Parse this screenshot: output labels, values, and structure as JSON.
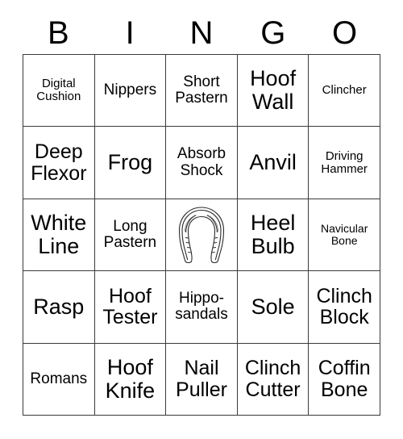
{
  "card": {
    "header_letters": [
      "B",
      "I",
      "N",
      "G",
      "O"
    ],
    "grid": [
      [
        {
          "text": "Digital Cushion",
          "size": "sm"
        },
        {
          "text": "Nippers",
          "size": "md"
        },
        {
          "text": "Short Pastern",
          "size": "md"
        },
        {
          "text": "Hoof Wall",
          "size": "xl"
        },
        {
          "text": "Clincher",
          "size": "sm"
        }
      ],
      [
        {
          "text": "Deep Flexor",
          "size": "lg"
        },
        {
          "text": "Frog",
          "size": "xl"
        },
        {
          "text": "Absorb Shock",
          "size": "md"
        },
        {
          "text": "Anvil",
          "size": "xl"
        },
        {
          "text": "Driving Hammer",
          "size": "sm"
        }
      ],
      [
        {
          "text": "White Line",
          "size": "xl"
        },
        {
          "text": "Long Pastern",
          "size": "md"
        },
        {
          "text": "",
          "size": "sm",
          "icon": "horseshoe-icon",
          "free_space": true
        },
        {
          "text": "Heel Bulb",
          "size": "xl"
        },
        {
          "text": "Navicular Bone",
          "size": "xs"
        }
      ],
      [
        {
          "text": "Rasp",
          "size": "xl"
        },
        {
          "text": "Hoof Tester",
          "size": "lg"
        },
        {
          "text": "Hippo-sandals",
          "size": "md"
        },
        {
          "text": "Sole",
          "size": "xl"
        },
        {
          "text": "Clinch Block",
          "size": "lg"
        }
      ],
      [
        {
          "text": "Romans",
          "size": "md"
        },
        {
          "text": "Hoof Knife",
          "size": "xl"
        },
        {
          "text": "Nail Puller",
          "size": "lg"
        },
        {
          "text": "Clinch Cutter",
          "size": "lg"
        },
        {
          "text": "Coffin Bone",
          "size": "lg"
        }
      ]
    ],
    "colors": {
      "background": "#ffffff",
      "text": "#000000",
      "border": "#3a3a3a"
    }
  }
}
